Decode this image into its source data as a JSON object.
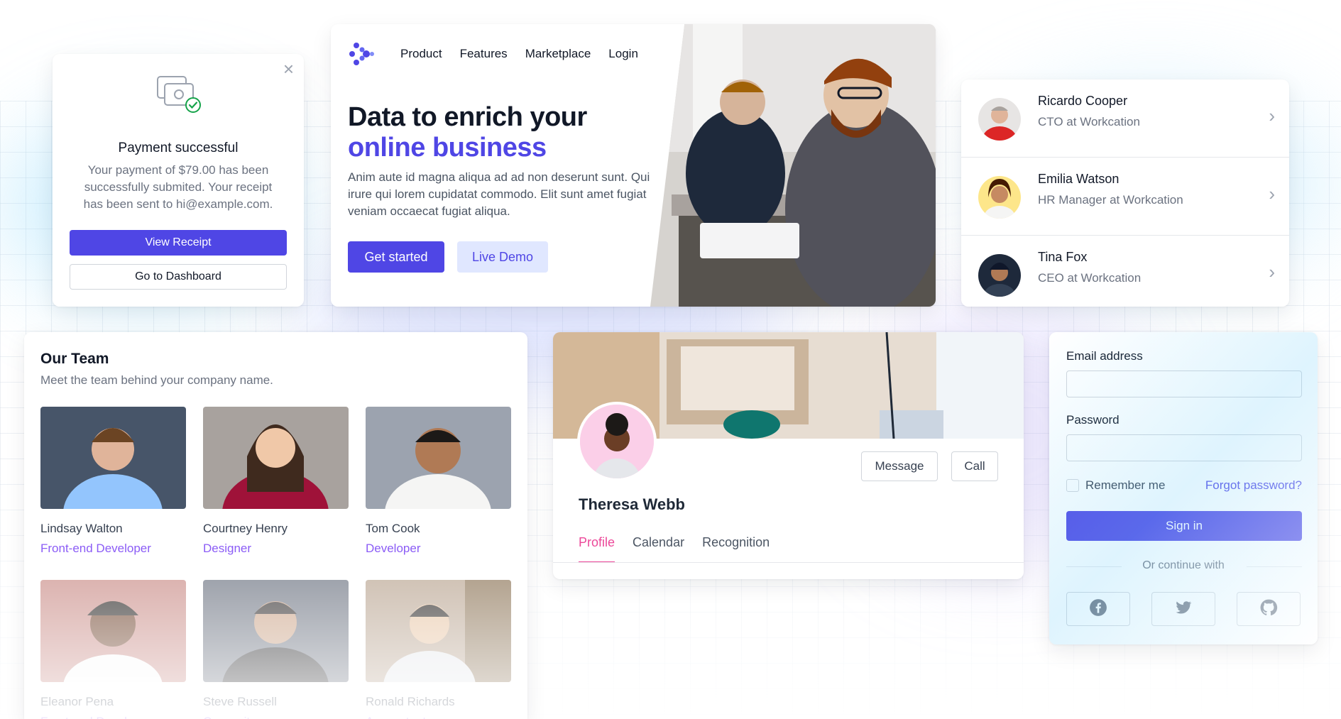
{
  "colors": {
    "brand": "#4f46e5",
    "brand_light": "#e0e7ff",
    "success": "#16a34a",
    "accent_pink": "#ec4899",
    "role_purple": "#8b5cf6"
  },
  "payment": {
    "title": "Payment successful",
    "message": "Your payment of $79.00 has been successfully submited. Your receipt has been sent to hi@example.com.",
    "view_receipt": "View Receipt",
    "go_to_dashboard": "Go to Dashboard",
    "icon": "payment-success-icon"
  },
  "hero": {
    "nav": [
      "Product",
      "Features",
      "Marketplace",
      "Login"
    ],
    "headline_line1": "Data to enrich your",
    "headline_line2": "online business",
    "description": "Anim aute id magna aliqua ad ad non deserunt sunt. Qui irure qui lorem cupidatat commodo. Elit sunt amet fugiat veniam occaecat fugiat aliqua.",
    "primary_cta": "Get started",
    "secondary_cta": "Live Demo"
  },
  "people": [
    {
      "name": "Ricardo Cooper",
      "role": "CTO at Workcation"
    },
    {
      "name": "Emilia Watson",
      "role": "HR Manager at Workcation"
    },
    {
      "name": "Tina Fox",
      "role": "CEO at Workcation"
    }
  ],
  "team": {
    "title": "Our Team",
    "subtitle": "Meet the team behind your company name.",
    "members": [
      {
        "name": "Lindsay Walton",
        "role": "Front-end Developer"
      },
      {
        "name": "Courtney Henry",
        "role": "Designer"
      },
      {
        "name": "Tom Cook",
        "role": "Developer"
      },
      {
        "name": "Eleanor Pena",
        "role": "Front-end Developer"
      },
      {
        "name": "Steve Russell",
        "role": "Copywriter"
      },
      {
        "name": "Ronald Richards",
        "role": "Accountant"
      }
    ]
  },
  "profile": {
    "name": "Theresa Webb",
    "message_button": "Message",
    "call_button": "Call",
    "tabs": [
      "Profile",
      "Calendar",
      "Recognition"
    ],
    "active_tab": "Profile"
  },
  "signin": {
    "email_label": "Email address",
    "password_label": "Password",
    "remember_label": "Remember me",
    "forgot_label": "Forgot password?",
    "submit_label": "Sign in",
    "divider_label": "Or continue with",
    "social": [
      "facebook-icon",
      "twitter-icon",
      "github-icon"
    ]
  }
}
